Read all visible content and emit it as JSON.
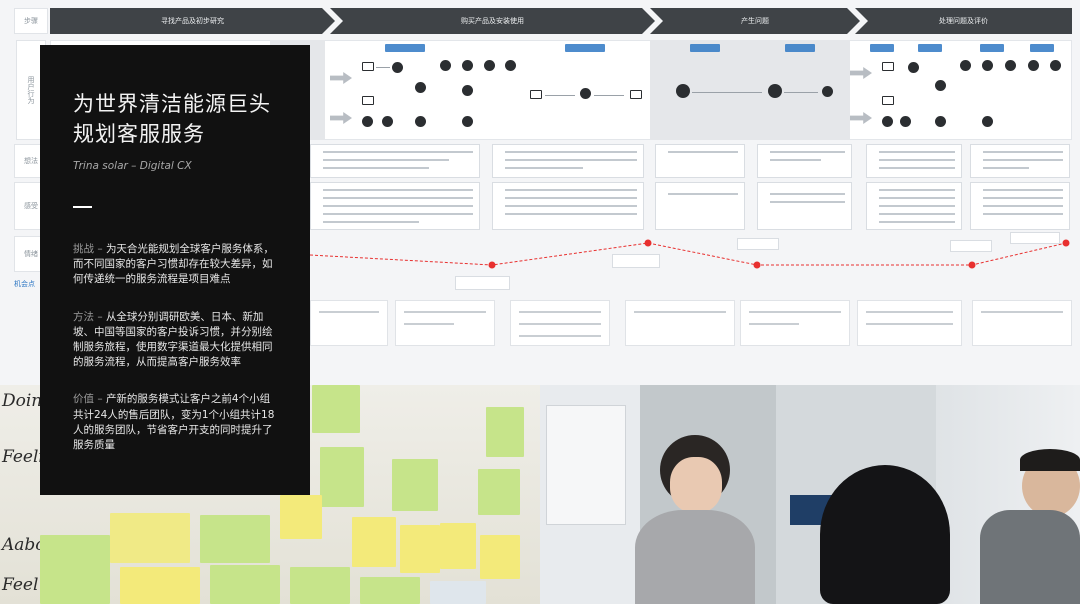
{
  "panel": {
    "title_line1": "为世界清洁能源巨头",
    "title_line2": "规划客服服务",
    "subtitle": "Trina solar –  Digital CX",
    "challenge": {
      "lead": "挑战 – ",
      "text": "为天合光能规划全球客户服务体系，而不同国家的客户习惯却存在较大差异，如何传递统一的服务流程是项目难点"
    },
    "method": {
      "lead": "方法 – ",
      "text": "从全球分别调研欧美、日本、新加坡、中国等国家的客户投诉习惯，并分别绘制服务旅程，使用数字渠道最大化提供相同的服务流程，从而提高客户服务效率"
    },
    "value": {
      "lead": "价值 – ",
      "text": "产新的服务模式让客户之前4个小组共计24人的售后团队，变为1个小组共计18人的服务团队，节省客户开支的同时提升了服务质量"
    }
  },
  "journey_map": {
    "stages": [
      "寻找产品及初步研究",
      "购买产品及安装使用",
      "产生问题",
      "处理问题及评价"
    ],
    "row_labels": [
      "步骤",
      "用户行为",
      "想法",
      "感受",
      "情绪"
    ],
    "side_labels": [
      "机会点"
    ]
  },
  "photos": {
    "left_board_words": [
      "Doing",
      "Feeli",
      "Aabo",
      "Feel"
    ]
  },
  "colors": {
    "panel_bg": "#111111",
    "stage_bar": "#3f4347",
    "accent_blue": "#2f78c4",
    "emotion_red": "#e8302f",
    "sticky_green": "#c7e58a",
    "sticky_yellow": "#f3ea7a"
  }
}
